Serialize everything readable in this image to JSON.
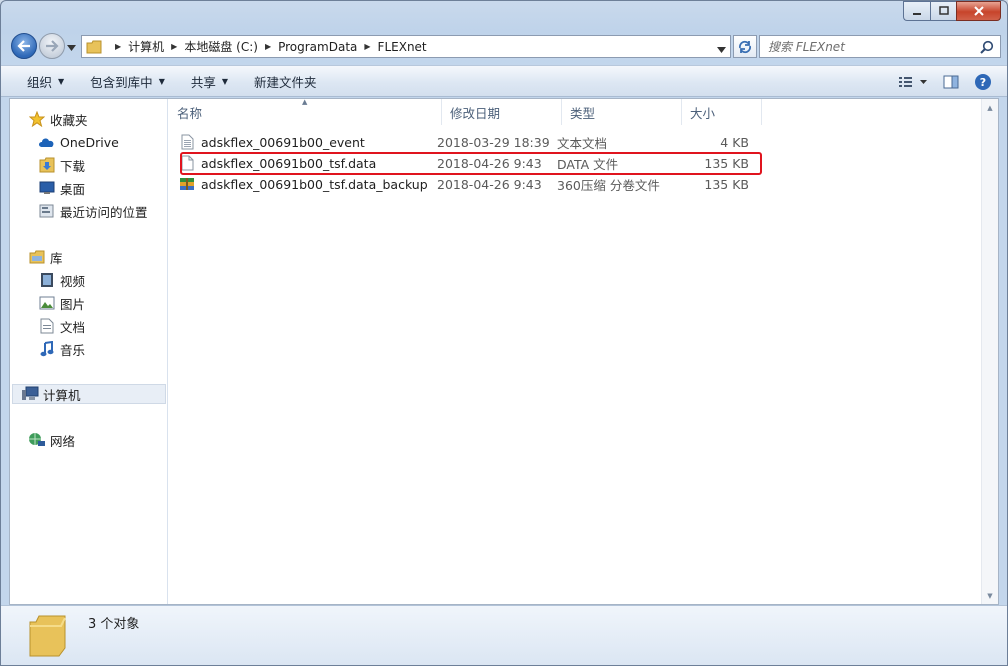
{
  "window": {
    "accent": "#2e68b7",
    "close_color": "#c7442b"
  },
  "address": {
    "crumbs": [
      "计算机",
      "本地磁盘 (C:)",
      "ProgramData",
      "FLEXnet"
    ]
  },
  "search": {
    "placeholder": "搜索 FLEXnet"
  },
  "toolbar": {
    "organize": "组织",
    "include_library": "包含到库中",
    "share": "共享",
    "new_folder": "新建文件夹"
  },
  "nav": {
    "favorites": "收藏夹",
    "onedrive": "OneDrive",
    "downloads": "下载",
    "desktop": "桌面",
    "recent": "最近访问的位置",
    "libraries": "库",
    "videos": "视频",
    "pictures": "图片",
    "documents": "文档",
    "music": "音乐",
    "computer": "计算机",
    "network": "网络"
  },
  "columns": {
    "name": "名称",
    "date": "修改日期",
    "type": "类型",
    "size": "大小"
  },
  "files": [
    {
      "name": "adskflex_00691b00_event",
      "date": "2018-03-29 18:39",
      "type": "文本文档",
      "size": "4 KB",
      "icon": "text-file-icon"
    },
    {
      "name": "adskflex_00691b00_tsf.data",
      "date": "2018-04-26 9:43",
      "type": "DATA 文件",
      "size": "135 KB",
      "icon": "blank-file-icon"
    },
    {
      "name": "adskflex_00691b00_tsf.data_backup",
      "date": "2018-04-26 9:43",
      "type": "360压缩 分卷文件",
      "size": "135 KB",
      "icon": "archive-file-icon"
    }
  ],
  "highlight_color": "#e0141e",
  "status": {
    "count": "3 个对象"
  }
}
